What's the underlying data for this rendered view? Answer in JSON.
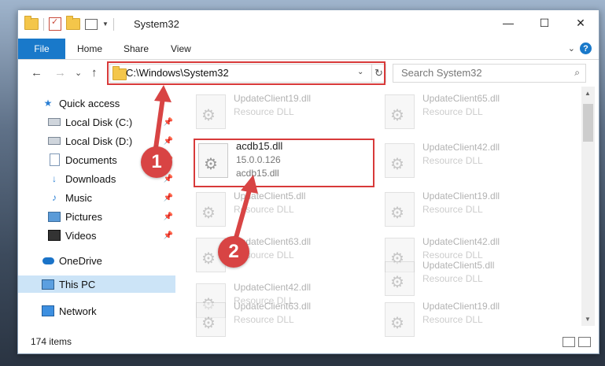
{
  "window": {
    "title": "System32",
    "controls": [
      "—",
      "☐",
      "✕"
    ]
  },
  "ribbon": {
    "file": "File",
    "tabs": [
      "Home",
      "Share",
      "View"
    ],
    "chevron": "⌄",
    "help": "?"
  },
  "nav": {
    "back": "←",
    "forward": "→",
    "recent": "⌄",
    "up": "↑",
    "address": "C:\\Windows\\System32",
    "address_dropdown": "⌄",
    "refresh": "↻",
    "search_placeholder": "Search System32",
    "search_icon": "⌕"
  },
  "sidebar": {
    "items": [
      {
        "label": "Quick access",
        "icon": "star-icon",
        "pinned": false
      },
      {
        "label": "Local Disk (C:)",
        "icon": "drive-icon",
        "pinned": true
      },
      {
        "label": "Local Disk (D:)",
        "icon": "drive-icon",
        "pinned": true
      },
      {
        "label": "Documents",
        "icon": "document-icon",
        "pinned": true
      },
      {
        "label": "Downloads",
        "icon": "download-icon",
        "pinned": true
      },
      {
        "label": "Music",
        "icon": "music-icon",
        "pinned": true
      },
      {
        "label": "Pictures",
        "icon": "pictures-icon",
        "pinned": true
      },
      {
        "label": "Videos",
        "icon": "videos-icon",
        "pinned": true
      },
      {
        "label": "OneDrive",
        "icon": "cloud-icon",
        "pinned": false
      },
      {
        "label": "This PC",
        "icon": "pc-icon",
        "pinned": false,
        "selected": true
      },
      {
        "label": "Network",
        "icon": "network-icon",
        "pinned": false
      }
    ],
    "pin_glyph": "📌"
  },
  "files": {
    "left": [
      {
        "name": "UpdateClient19.dll",
        "desc": "Resource DLL"
      },
      {
        "name": "acdb15.dll",
        "desc": "15.0.0.126",
        "extra": "acdb15.dll",
        "highlighted": true
      },
      {
        "name": "UpdateClient5.dll",
        "desc": "Resource DLL"
      },
      {
        "name": "UpdateClient63.dll",
        "desc": "Resource DLL"
      },
      {
        "name": "UpdateClient42.dll",
        "desc": "Resource DLL"
      },
      {
        "name": "UpdateClient63.dll",
        "desc": "Resource DLL"
      }
    ],
    "right": [
      {
        "name": "UpdateClient65.dll",
        "desc": "Resource DLL"
      },
      {
        "name": "UpdateClient42.dll",
        "desc": "Resource DLL"
      },
      {
        "name": "UpdateClient19.dll",
        "desc": "Resource DLL"
      },
      {
        "name": "UpdateClient42.dll",
        "desc": "Resource DLL"
      },
      {
        "name": "UpdateClient5.dll",
        "desc": "Resource DLL"
      },
      {
        "name": "UpdateClient19.dll",
        "desc": "Resource DLL"
      }
    ]
  },
  "status": {
    "count": "174 items"
  },
  "annotations": {
    "marker1": "1",
    "marker2": "2",
    "color": "#d83a3a"
  }
}
